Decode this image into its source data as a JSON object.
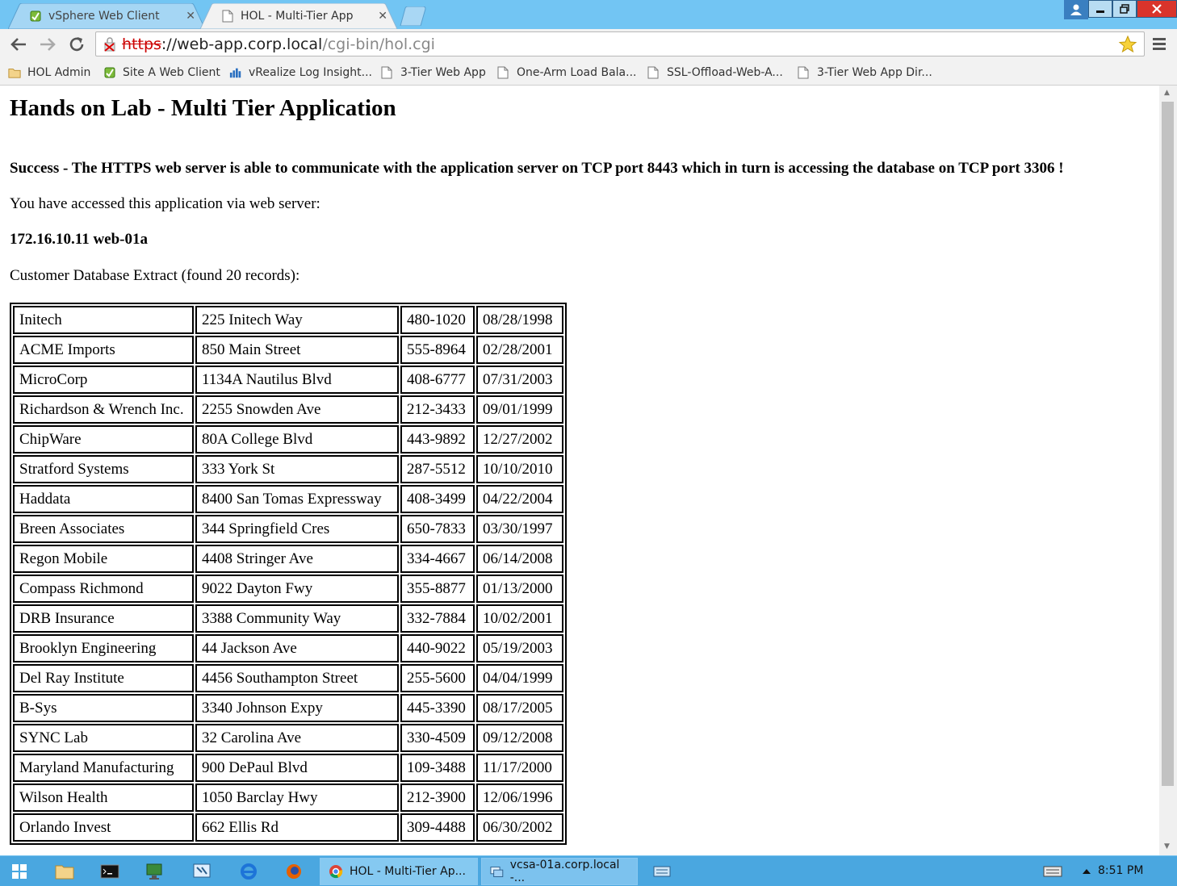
{
  "browser": {
    "tabs": [
      {
        "label": "vSphere Web Client",
        "active": false,
        "icon": "vsphere-icon"
      },
      {
        "label": "HOL - Multi-Tier App",
        "active": true,
        "icon": "page-icon"
      }
    ],
    "address": {
      "scheme": "https",
      "host": "://web-app.corp.local",
      "path": "/cgi-bin/hol.cgi"
    },
    "bookmarks": [
      {
        "label": "HOL Admin",
        "icon": "folder-icon"
      },
      {
        "label": "Site A Web Client",
        "icon": "vsphere-icon"
      },
      {
        "label": "vRealize Log Insight...",
        "icon": "chart-icon"
      },
      {
        "label": "3-Tier Web App",
        "icon": "page-icon"
      },
      {
        "label": "One-Arm Load Bala...",
        "icon": "page-icon"
      },
      {
        "label": "SSL-Offload-Web-A...",
        "icon": "page-icon"
      },
      {
        "label": "3-Tier Web App Dir...",
        "icon": "page-icon"
      }
    ]
  },
  "page": {
    "title": "Hands on Lab - Multi Tier Application",
    "success": "Success - The HTTPS web server is able to communicate with the application server on TCP port 8443 which in turn is accessing the database on TCP port 3306 !",
    "accessed": "You have accessed this application via web server:",
    "server": "172.16.10.11 web-01a",
    "extract": "Customer Database Extract (found 20 records):",
    "rows": [
      [
        "Initech",
        "225 Initech Way",
        "480-1020",
        "08/28/1998"
      ],
      [
        "ACME Imports",
        "850 Main Street",
        "555-8964",
        "02/28/2001"
      ],
      [
        "MicroCorp",
        "1134A Nautilus Blvd",
        "408-6777",
        "07/31/2003"
      ],
      [
        "Richardson & Wrench Inc.",
        "2255 Snowden Ave",
        "212-3433",
        "09/01/1999"
      ],
      [
        "ChipWare",
        "80A College Blvd",
        "443-9892",
        "12/27/2002"
      ],
      [
        "Stratford Systems",
        "333 York St",
        "287-5512",
        "10/10/2010"
      ],
      [
        "Haddata",
        "8400 San Tomas Expressway",
        "408-3499",
        "04/22/2004"
      ],
      [
        "Breen Associates",
        "344 Springfield Cres",
        "650-7833",
        "03/30/1997"
      ],
      [
        "Regon Mobile",
        "4408 Stringer Ave",
        "334-4667",
        "06/14/2008"
      ],
      [
        "Compass Richmond",
        "9022 Dayton Fwy",
        "355-8877",
        "01/13/2000"
      ],
      [
        "DRB Insurance",
        "3388 Community Way",
        "332-7884",
        "10/02/2001"
      ],
      [
        "Brooklyn Engineering",
        "44 Jackson Ave",
        "440-9022",
        "05/19/2003"
      ],
      [
        "Del Ray Institute",
        "4456 Southampton Street",
        "255-5600",
        "04/04/1999"
      ],
      [
        "B-Sys",
        "3340 Johnson Expy",
        "445-3390",
        "08/17/2005"
      ],
      [
        "SYNC Lab",
        "32 Carolina Ave",
        "330-4509",
        "09/12/2008"
      ],
      [
        "Maryland Manufacturing",
        "900 DePaul Blvd",
        "109-3488",
        "11/17/2000"
      ],
      [
        "Wilson Health",
        "1050 Barclay Hwy",
        "212-3900",
        "12/06/1996"
      ],
      [
        "Orlando Invest",
        "662 Ellis Rd",
        "309-4488",
        "06/30/2002"
      ]
    ]
  },
  "taskbar": {
    "apps": [
      {
        "label": "HOL - Multi-Tier Ap...",
        "icon": "chrome-icon"
      },
      {
        "label": "vcsa-01a.corp.local -...",
        "icon": "remote-desktop-icon"
      }
    ],
    "clock": "8:51 PM"
  },
  "colors": {
    "titlebar": "#72c5f3",
    "taskbar": "#4aa7e0",
    "close": "#d9342b"
  }
}
